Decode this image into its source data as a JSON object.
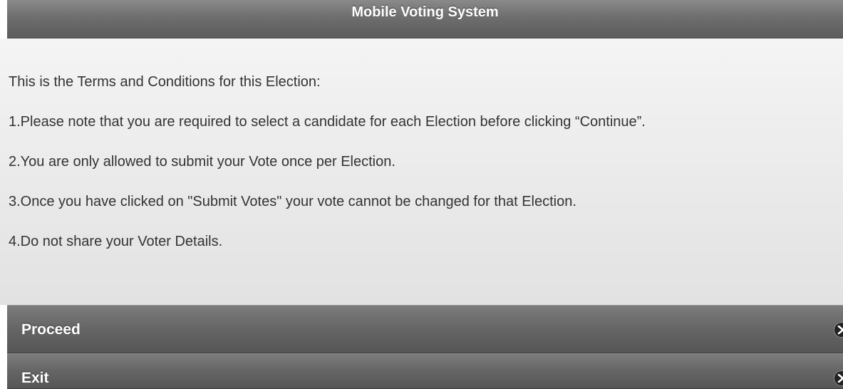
{
  "header": {
    "title": "Mobile Voting System"
  },
  "terms": {
    "intro": "This is the Terms and Conditions for this Election:",
    "items": [
      "1.Please note that you are required to select a candidate for each Election before clicking “Continue”.",
      "2.You are only allowed to submit your Vote once per Election.",
      "3.Once you have clicked on \"Submit Votes\" your vote cannot be changed for that Election.",
      "4.Do not share your Voter Details."
    ]
  },
  "actions": {
    "proceed_label": "Proceed",
    "exit_label": "Exit",
    "arrow_icon": "arrow-right-icon"
  },
  "colors": {
    "header_bg": "#6e6e6e",
    "button_bg": "#656565",
    "content_bg": "#ececec",
    "text": "#333333"
  }
}
